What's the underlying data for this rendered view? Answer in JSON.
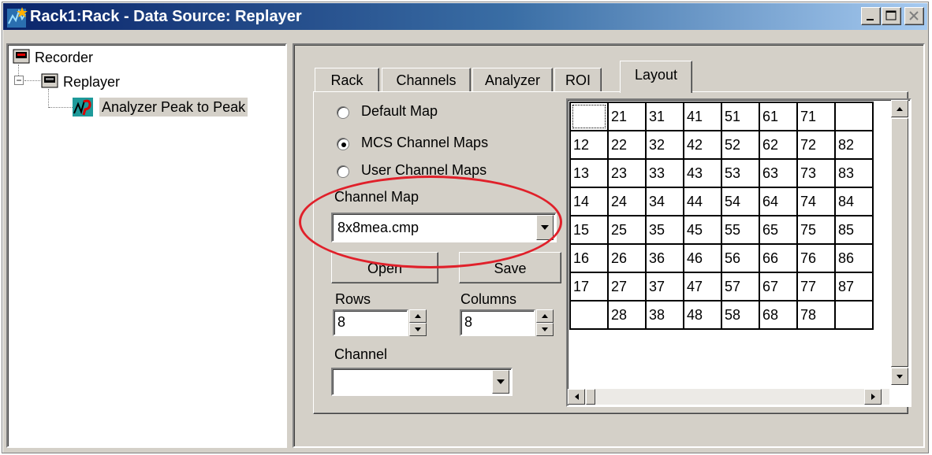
{
  "window": {
    "title": "Rack1:Rack - Data Source: Replayer",
    "controls": {
      "minimize": "_",
      "maximize": "□",
      "close": "×"
    }
  },
  "tree": {
    "items": [
      {
        "label": "Recorder",
        "icon": "recorder-icon",
        "level": 0
      },
      {
        "label": "Replayer",
        "icon": "replayer-icon",
        "level": 1,
        "expander": "−"
      },
      {
        "label": "Analyzer Peak to Peak",
        "icon": "analyzer-icon",
        "level": 2,
        "selected": true
      }
    ]
  },
  "tabs": [
    {
      "label": "Rack"
    },
    {
      "label": "Channels"
    },
    {
      "label": "Analyzer"
    },
    {
      "label": "ROI"
    },
    {
      "label": "Layout",
      "active": true
    }
  ],
  "layout": {
    "radios": [
      {
        "label": "Default Map",
        "checked": false
      },
      {
        "label": "MCS Channel Maps",
        "checked": true
      },
      {
        "label": "User Channel Maps",
        "checked": false
      }
    ],
    "channel_map_label": "Channel Map",
    "channel_map_value": "8x8mea.cmp",
    "open_label": "Open",
    "save_label": "Save",
    "rows_label": "Rows",
    "rows_value": "8",
    "columns_label": "Columns",
    "columns_value": "8",
    "channel_label": "Channel",
    "channel_value": "",
    "grid": [
      [
        "",
        "21",
        "31",
        "41",
        "51",
        "61",
        "71",
        ""
      ],
      [
        "12",
        "22",
        "32",
        "42",
        "52",
        "62",
        "72",
        "82"
      ],
      [
        "13",
        "23",
        "33",
        "43",
        "53",
        "63",
        "73",
        "83"
      ],
      [
        "14",
        "24",
        "34",
        "44",
        "54",
        "64",
        "74",
        "84"
      ],
      [
        "15",
        "25",
        "35",
        "45",
        "55",
        "65",
        "75",
        "85"
      ],
      [
        "16",
        "26",
        "36",
        "46",
        "56",
        "66",
        "76",
        "86"
      ],
      [
        "17",
        "27",
        "37",
        "47",
        "57",
        "67",
        "77",
        "87"
      ],
      [
        "",
        "28",
        "38",
        "48",
        "58",
        "68",
        "78",
        ""
      ]
    ]
  },
  "colors": {
    "titlebar_start": "#0a246a",
    "titlebar_end": "#a6caf0",
    "window_bg": "#d4d0c8",
    "highlight_ellipse": "#e0202a"
  }
}
